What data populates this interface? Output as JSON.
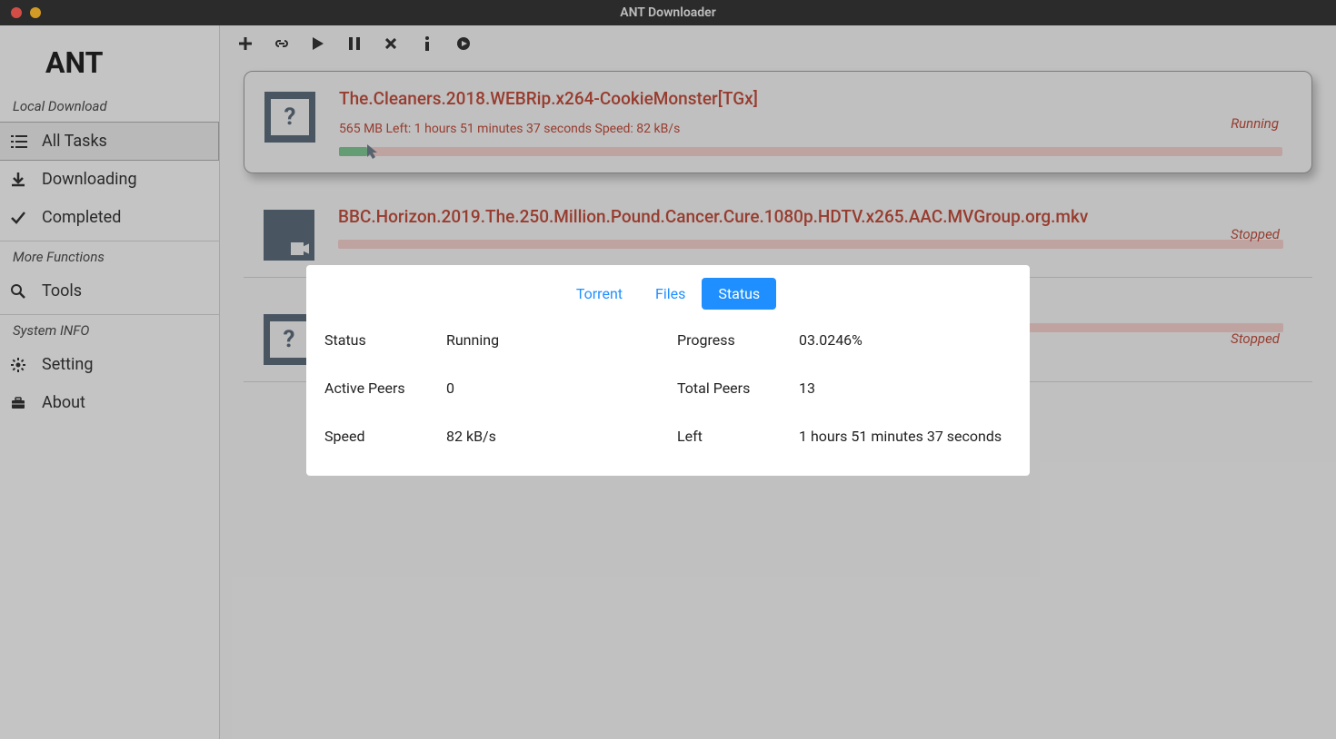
{
  "window": {
    "title": "ANT Downloader"
  },
  "sidebar": {
    "brand": "ANT",
    "sections": [
      {
        "label": "Local Download",
        "items": [
          {
            "icon": "list",
            "label": "All Tasks",
            "active": true
          },
          {
            "icon": "download",
            "label": "Downloading",
            "active": false
          },
          {
            "icon": "check",
            "label": "Completed",
            "active": false
          }
        ]
      },
      {
        "label": "More Functions",
        "items": [
          {
            "icon": "search",
            "label": "Tools",
            "active": false
          }
        ]
      },
      {
        "label": "System INFO",
        "items": [
          {
            "icon": "gear",
            "label": "Setting",
            "active": false
          },
          {
            "icon": "briefcase",
            "label": "About",
            "active": false
          }
        ]
      }
    ]
  },
  "toolbar": {
    "buttons": [
      "add",
      "link",
      "play",
      "pause",
      "cancel",
      "info",
      "circle-play"
    ]
  },
  "tasks": [
    {
      "icon": "unknown",
      "title": "The.Cleaners.2018.WEBRip.x264-CookieMonster[TGx]",
      "meta": "565 MB Left: 1 hours 51 minutes 37 seconds Speed: 82 kB/s",
      "status": "Running",
      "progress_pct": 3,
      "selected": true
    },
    {
      "icon": "video",
      "title": "BBC.Horizon.2019.The.250.Million.Pound.Cancer.Cure.1080p.HDTV.x265.AAC.MVGroup.org.mkv",
      "meta": "",
      "status": "Stopped",
      "progress_pct": 0,
      "selected": false
    },
    {
      "icon": "unknown",
      "title": "",
      "meta": "",
      "status": "Stopped",
      "progress_pct": 0,
      "selected": false
    }
  ],
  "modal": {
    "tabs": [
      {
        "label": "Torrent",
        "active": false
      },
      {
        "label": "Files",
        "active": false
      },
      {
        "label": "Status",
        "active": true
      }
    ],
    "rows": [
      {
        "k1": "Status",
        "v1": "Running",
        "k2": "Progress",
        "v2": "03.0246%"
      },
      {
        "k1": "Active Peers",
        "v1": "0",
        "k2": "Total Peers",
        "v2": "13"
      },
      {
        "k1": "Speed",
        "v1": "82 kB/s",
        "k2": "Left",
        "v2": "1 hours 51 minutes 37 seconds"
      }
    ]
  }
}
